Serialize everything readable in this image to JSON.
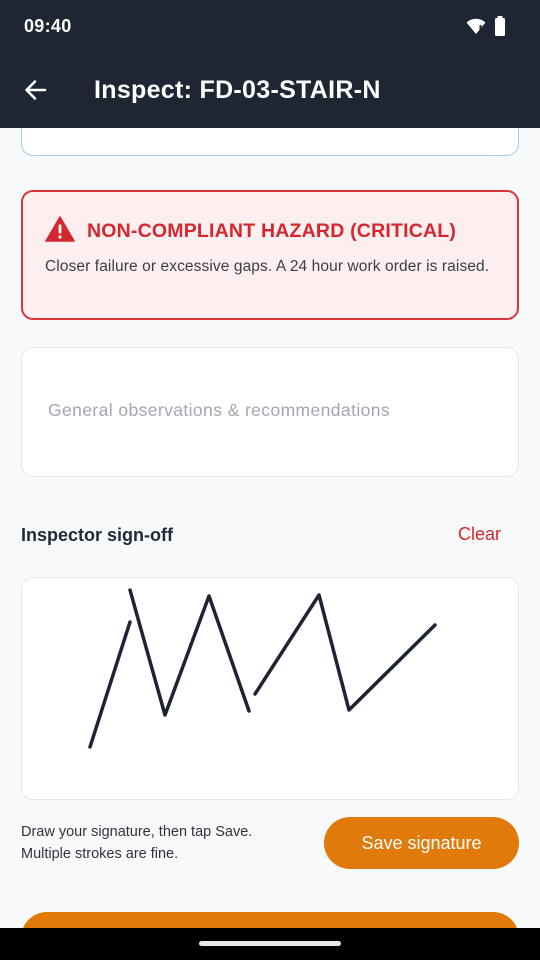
{
  "status_bar": {
    "time": "09:40",
    "icons": [
      "wifi-icon",
      "battery-icon"
    ]
  },
  "app_bar": {
    "back_icon": "arrow-left-icon",
    "title": "Inspect: FD-03-STAIR-N"
  },
  "hazard": {
    "icon": "warning-triangle-icon",
    "title": "NON-COMPLIANT HAZARD (CRITICAL)",
    "body": "Closer failure or excessive gaps. A 24 hour work order is raised.",
    "color": "#d4282e",
    "background": "#fdeef0"
  },
  "notes": {
    "value": "",
    "placeholder": "General observations & recommendations"
  },
  "signoff": {
    "label": "Inspector sign-off",
    "clear_label": "Clear",
    "hint_line1": "Draw your signature, then tap Save.",
    "hint_line2": "Multiple strokes are fine.",
    "save_label": "Save signature",
    "accent": "#e07a0b"
  },
  "colors": {
    "app_bar": "#1e2533",
    "danger": "#d4282e",
    "accent": "#e07a0b"
  }
}
